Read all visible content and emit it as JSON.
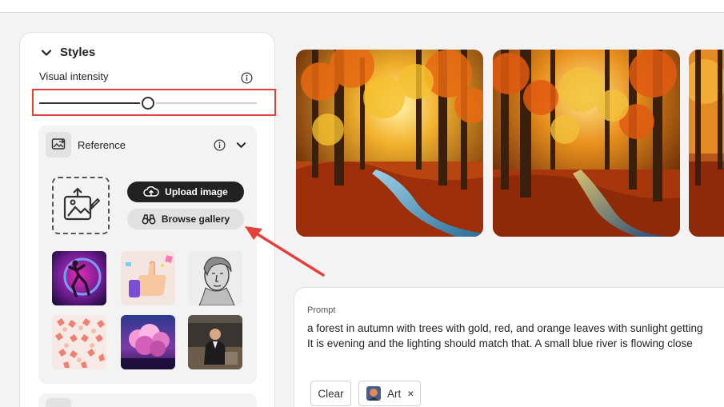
{
  "styles": {
    "title": "Styles",
    "visual_intensity_label": "Visual intensity",
    "slider_value_fraction": 0.5
  },
  "reference": {
    "title": "Reference",
    "upload_label": "Upload image",
    "browse_label": "Browse gallery",
    "thumbnails": [
      {
        "name": "neon-dancer-thumbnail"
      },
      {
        "name": "thumbs-up-hand-thumbnail"
      },
      {
        "name": "engraving-portrait-thumbnail"
      },
      {
        "name": "hands-pattern-thumbnail"
      },
      {
        "name": "pink-clouds-thumbnail"
      },
      {
        "name": "man-in-suit-thumbnail"
      }
    ]
  },
  "gallery": {
    "images": [
      {
        "name": "autumn-forest-image-1"
      },
      {
        "name": "autumn-forest-image-2"
      },
      {
        "name": "autumn-forest-image-3"
      }
    ]
  },
  "prompt": {
    "label": "Prompt",
    "line1": "a forest in autumn with trees with gold, red, and orange leaves with sunlight getting",
    "line2": "It is evening and the lighting should match that. A small blue river is flowing close",
    "clear_label": "Clear",
    "style_chip_label": "Art",
    "style_chip_remove": "×"
  },
  "colors": {
    "highlight": "#e5403a",
    "arrow": "#e5403a",
    "dark_button": "#222222"
  }
}
